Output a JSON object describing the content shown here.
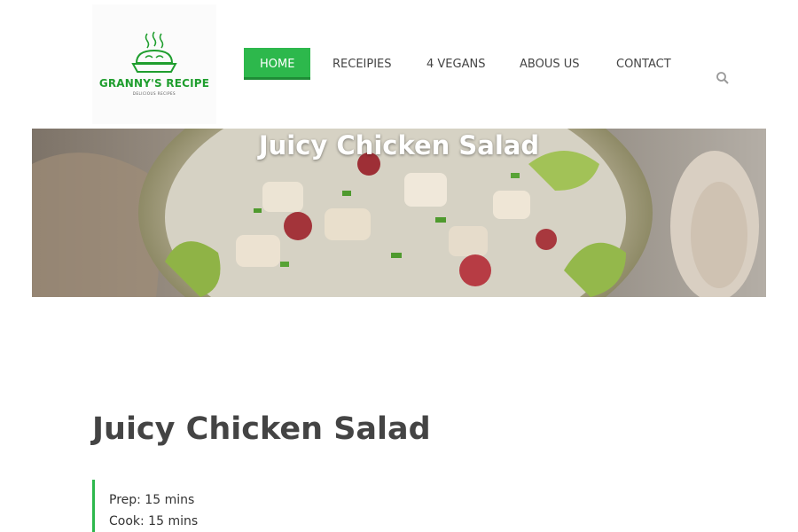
{
  "logo": {
    "title": "GRANNY'S RECIPE",
    "subtitle": "DELICIOUS RECIPES",
    "icon": "pie-icon",
    "color": "#1f9e2e"
  },
  "nav": {
    "items": [
      {
        "label": "HOME",
        "active": true
      },
      {
        "label": "RECEIPIES",
        "active": false
      },
      {
        "label": "4 VEGANS",
        "active": false
      },
      {
        "label": "ABOUS US",
        "active": false
      },
      {
        "label": "CONTACT",
        "active": false
      }
    ],
    "search_icon": "search-icon",
    "accent": "#2db84c"
  },
  "hero": {
    "title": "Juicy Chicken Salad"
  },
  "article": {
    "title": "Juicy Chicken Salad",
    "prep": "Prep: 15 mins",
    "cook": "Cook: 15 mins"
  }
}
